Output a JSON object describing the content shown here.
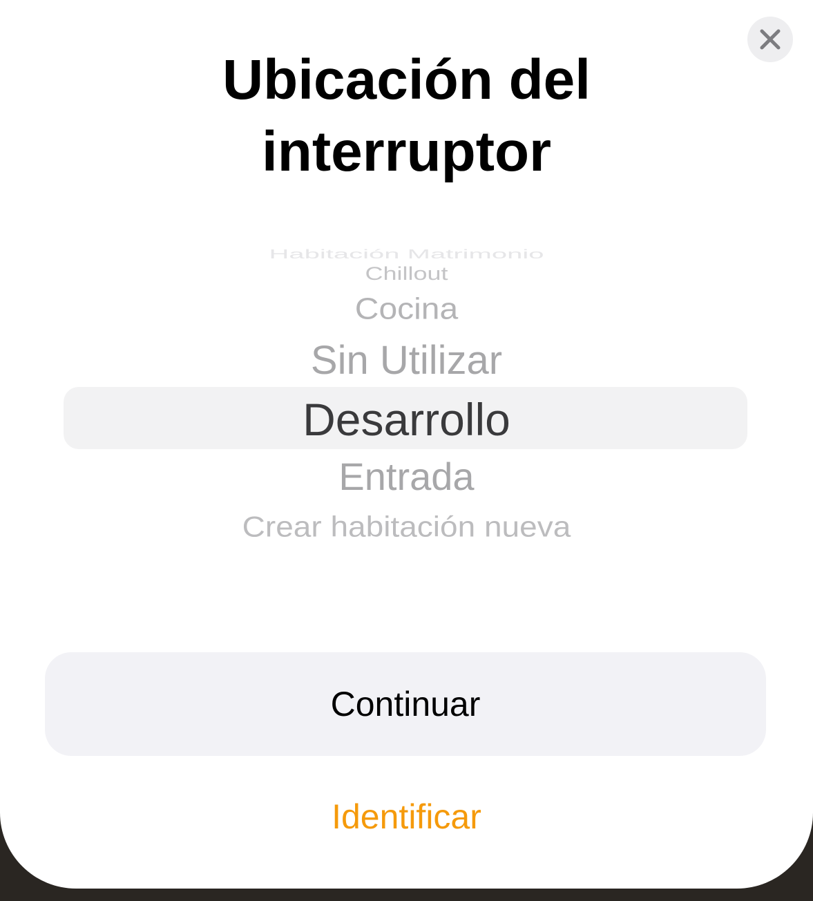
{
  "header": {
    "close_icon": "close-icon",
    "title_line1": "Ubicación del",
    "title_line2": "interruptor"
  },
  "picker": {
    "items": [
      "Habitación Matrimonio",
      "Chillout",
      "Cocina",
      "Sin Utilizar",
      "Desarrollo",
      "Entrada",
      "Crear habitación nueva"
    ],
    "selected": "Desarrollo"
  },
  "actions": {
    "continue_label": "Continuar",
    "identify_label": "Identificar"
  },
  "colors": {
    "accent": "#f59a0b",
    "button_bg": "#f2f2f6",
    "selection_bg": "#f2f2f3"
  }
}
